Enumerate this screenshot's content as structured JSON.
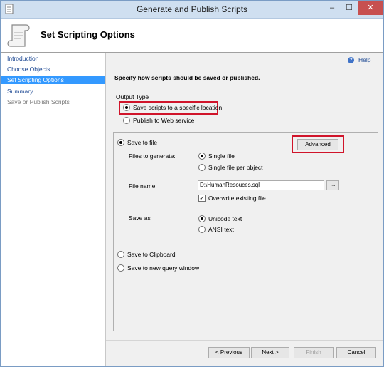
{
  "window": {
    "title": "Generate and Publish Scripts",
    "min": "–",
    "max": "☐",
    "close": "✕"
  },
  "header": {
    "title": "Set Scripting Options"
  },
  "sidebar": {
    "items": [
      {
        "label": "Introduction",
        "state": "link"
      },
      {
        "label": "Choose Objects",
        "state": "link"
      },
      {
        "label": "Set Scripting Options",
        "state": "active"
      },
      {
        "label": "Summary",
        "state": "link"
      },
      {
        "label": "Save or Publish Scripts",
        "state": "disabled"
      }
    ]
  },
  "help": {
    "label": "Help"
  },
  "main": {
    "instruction": "Specify how scripts should be saved or published.",
    "output_type": {
      "label": "Output Type",
      "options": [
        "Save scripts to a specific location",
        "Publish to Web service"
      ],
      "selected": 0
    },
    "save_to_file": "Save to file",
    "advanced": "Advanced",
    "files_to_generate": {
      "label": "Files to generate:",
      "options": [
        "Single file",
        "Single file per object"
      ],
      "selected": 0
    },
    "file_name": {
      "label": "File name:",
      "value": "D:\\HumanResouces.sql",
      "browse": "..."
    },
    "overwrite": {
      "label": "Overwrite existing file",
      "checked": true
    },
    "save_as": {
      "label": "Save as",
      "options": [
        "Unicode text",
        "ANSI text"
      ],
      "selected": 0
    },
    "clipboard": "Save to Clipboard",
    "query_window": "Save to new query window"
  },
  "footer": {
    "previous": "< Previous",
    "next": "Next >",
    "finish": "Finish",
    "cancel": "Cancel"
  }
}
